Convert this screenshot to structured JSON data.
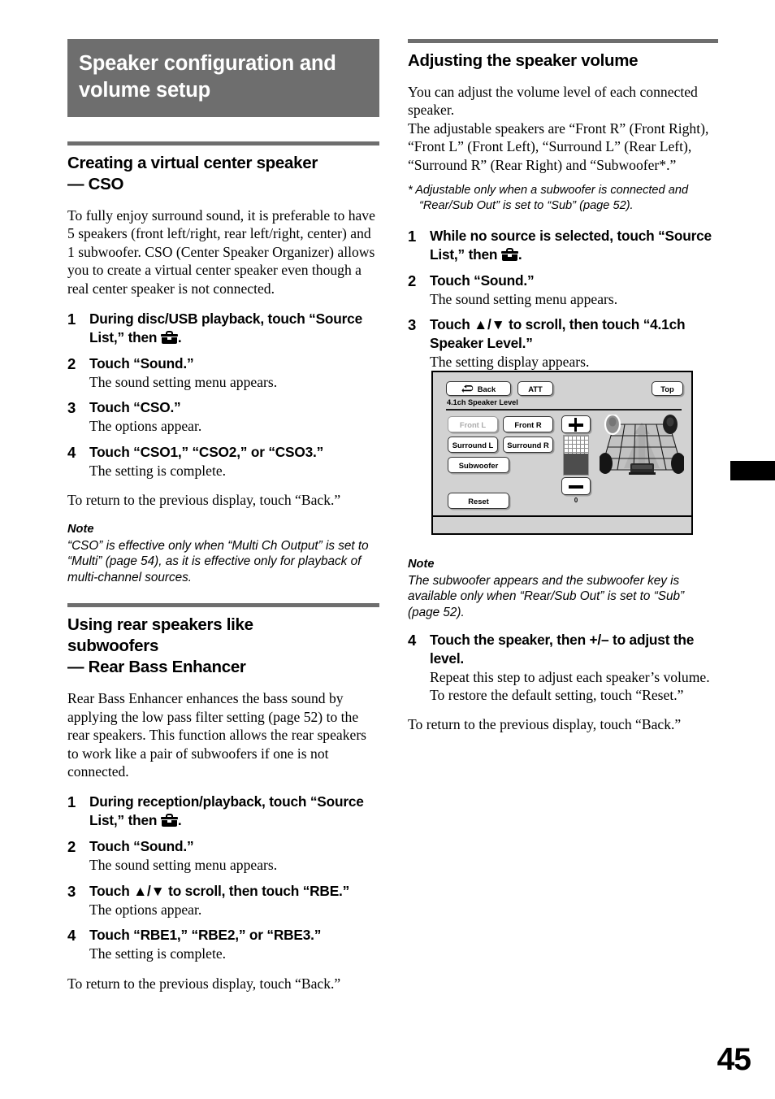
{
  "chapter_banner": "Speaker configuration and volume setup",
  "left_column": {
    "section1": {
      "heading_line1": "Creating a virtual center speaker",
      "heading_line2": "— CSO",
      "intro": "To fully enjoy surround sound, it is preferable to have 5 speakers (front left/right, rear left/right, center) and 1 subwoofer. CSO (Center Speaker Organizer) allows you to create a virtual center speaker even though a real center speaker is not connected.",
      "steps": [
        {
          "num": "1",
          "instruction_a": "During disc/USB playback, touch “Source List,” then ",
          "instruction_b": ".",
          "sub": ""
        },
        {
          "num": "2",
          "instruction_a": "Touch “Sound.”",
          "instruction_b": "",
          "sub": "The sound setting menu appears."
        },
        {
          "num": "3",
          "instruction_a": "Touch “CSO.”",
          "instruction_b": "",
          "sub": "The options appear."
        },
        {
          "num": "4",
          "instruction_a": "Touch “CSO1,” “CSO2,” or “CSO3.”",
          "instruction_b": "",
          "sub": "The setting is complete."
        }
      ],
      "closing": "To return to the previous display, touch “Back.”",
      "note_heading": "Note",
      "note_text": "“CSO” is effective only when “Multi Ch Output” is set to “Multi” (page 54), as it is effective only for playback of multi-channel sources."
    },
    "section2": {
      "heading_line1": "Using rear speakers like",
      "heading_line2": "subwoofers",
      "heading_line3": "— Rear Bass Enhancer",
      "intro": "Rear Bass Enhancer enhances the bass sound by applying the low pass filter setting (page 52) to the rear speakers. This function allows the rear speakers to work like a pair of subwoofers if one is not connected.",
      "steps": [
        {
          "num": "1",
          "instruction_a": "During reception/playback, touch “Source List,” then ",
          "instruction_b": ".",
          "sub": ""
        },
        {
          "num": "2",
          "instruction_a": "Touch “Sound.”",
          "instruction_b": "",
          "sub": "The sound setting menu appears."
        },
        {
          "num": "3",
          "instruction_a": "Touch ▲/▼ to scroll, then touch “RBE.”",
          "instruction_b": "",
          "sub": "The options appear."
        },
        {
          "num": "4",
          "instruction_a": "Touch “RBE1,” “RBE2,” or “RBE3.”",
          "instruction_b": "",
          "sub": "The setting is complete."
        }
      ],
      "closing": "To return to the previous display, touch “Back.”"
    }
  },
  "right_column": {
    "section": {
      "heading": "Adjusting the speaker volume",
      "intro": "You can adjust the volume level of each connected speaker.\nThe adjustable speakers are “Front R” (Front Right), “Front L” (Front Left), “Surround L” (Rear Left), “Surround R” (Rear Right) and “Subwoofer*.”",
      "footnote": "* Adjustable only when a subwoofer is connected and “Rear/Sub Out” is set to “Sub” (page 52).",
      "steps_before_figure": [
        {
          "num": "1",
          "instruction_a": "While no source is selected, touch “Source List,” then ",
          "instruction_b": ".",
          "sub": ""
        },
        {
          "num": "2",
          "instruction_a": "Touch “Sound.”",
          "instruction_b": "",
          "sub": "The sound setting menu appears."
        },
        {
          "num": "3",
          "instruction_a": "Touch ▲/▼ to scroll, then touch “4.1ch Speaker Level.”",
          "instruction_b": "",
          "sub": "The setting display appears."
        }
      ],
      "note_heading": "Note",
      "note_text": "The subwoofer appears and the subwoofer key is available only when “Rear/Sub Out” is set to “Sub” (page 52).",
      "steps_after_figure": [
        {
          "num": "4",
          "instruction_a": "Touch the speaker, then +/– to adjust the level.",
          "instruction_b": "",
          "sub": "Repeat this step to adjust each speaker’s volume.\nTo restore the default setting, touch “Reset.”"
        }
      ],
      "closing": "To return to the previous display, touch “Back.”"
    }
  },
  "device_figure": {
    "back_button": "Back",
    "att_button": "ATT",
    "top_button": "Top",
    "screen_title": "4.1ch Speaker Level",
    "speaker_buttons": [
      {
        "label": "Front L",
        "state": "dimmed"
      },
      {
        "label": "Front R",
        "state": "normal"
      },
      {
        "label": "Surround L",
        "state": "normal"
      },
      {
        "label": "Surround R",
        "state": "normal"
      },
      {
        "label": "Subwoofer",
        "state": "normal"
      }
    ],
    "reset_button": "Reset",
    "slider": {
      "plus_icon": "plus-icon",
      "minus_icon": "minus-icon",
      "value": "0"
    },
    "cabin_diagram": {
      "icon": "car-cabin-speaker-layout",
      "speakers": [
        "front-left",
        "front-right",
        "rear-left",
        "rear-right"
      ],
      "subwoofer": "subwoofer-box"
    }
  },
  "folio": "45",
  "colors": {
    "banner_gray": "#6e6e6e",
    "rule_gray": "#6e6e6e",
    "device_bg": "#d2d2d2",
    "slider_fill": "#4d4d4d"
  }
}
